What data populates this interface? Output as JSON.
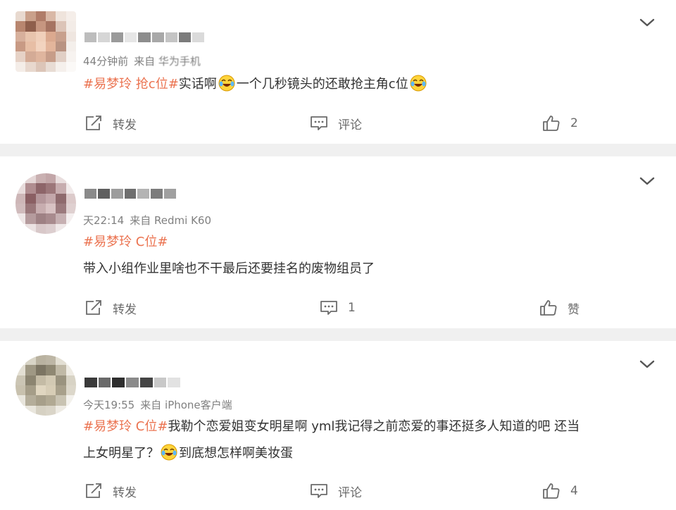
{
  "posts": [
    {
      "time": "44分钟前",
      "source_prefix": "来自",
      "source": "华为手机",
      "topic": "#易梦玲 抢c位#",
      "text1": "实话啊",
      "text2": "一个几秒镜头的还敢抢主角c位",
      "repost_label": "转发",
      "comment_label": "评论",
      "like_count": "2"
    },
    {
      "time": "天22:14",
      "source_prefix": "来自",
      "source": "Redmi K60",
      "topic": "#易梦玲 C位#",
      "text1": "带入小组作业里啥也不干最后还要挂名的废物组员了",
      "repost_label": "转发",
      "comment_count": "1",
      "like_label": "赞"
    },
    {
      "time": "今天19:55",
      "source_prefix": "来自",
      "source": "iPhone客户端",
      "topic": "#易梦玲 C位#",
      "text1": "我勒个恋爱姐变女明星啊 yml我记得之前恋爱的事还挺多人知道的吧 还当",
      "text2": "上女明星了？",
      "text3": "到底想怎样啊美妆蛋",
      "repost_label": "转发",
      "comment_label": "评论",
      "like_count": "4"
    }
  ],
  "icons": {
    "repost": "repost-icon",
    "comment": "comment-icon",
    "like": "thumbs-up-icon",
    "more": "chevron-down-icon",
    "emoji": "laugh-cry-emoji"
  },
  "colors": {
    "topic": "#eb7350",
    "text": "#333333",
    "meta": "#808080",
    "action": "#6b6b6b"
  }
}
